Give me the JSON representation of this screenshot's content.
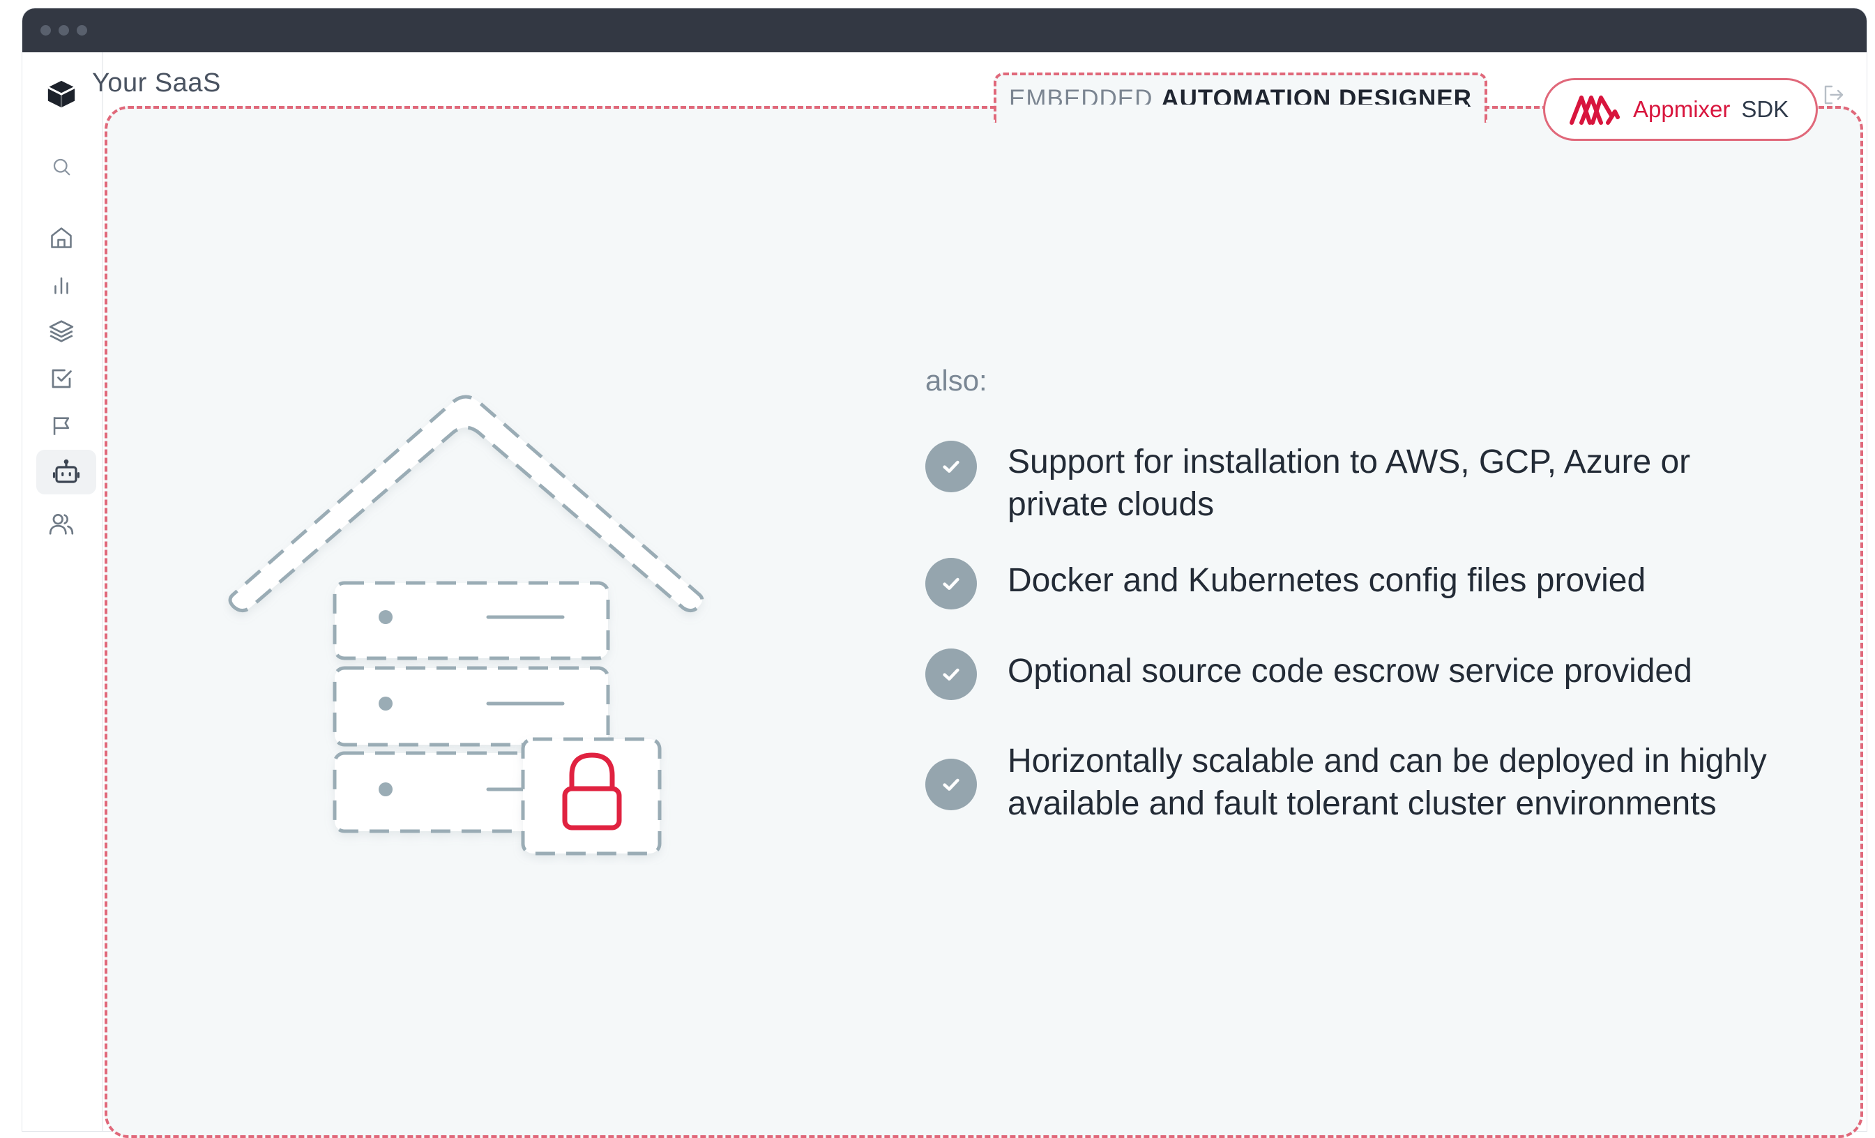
{
  "app": {
    "title": "Your SaaS"
  },
  "sidebar": {
    "items": [
      {
        "icon": "cube-logo-icon"
      },
      {
        "icon": "search-icon"
      },
      {
        "icon": "home-icon"
      },
      {
        "icon": "bar-chart-icon"
      },
      {
        "icon": "layers-icon"
      },
      {
        "icon": "checkbox-icon"
      },
      {
        "icon": "flag-icon"
      },
      {
        "icon": "robot-icon",
        "active": true
      },
      {
        "icon": "users-icon"
      }
    ]
  },
  "designer": {
    "label_muted": "EMBEDDED",
    "label_strong": "AUTOMATION DESIGNER"
  },
  "sdk_badge": {
    "name": "Appmixer",
    "tag": "SDK"
  },
  "content": {
    "intro": "also:",
    "features": [
      {
        "line1": "Support for installation to AWS, GCP, Azure or",
        "line2": "private clouds"
      },
      {
        "line1": "Docker and Kubernetes config files provied",
        "line2": ""
      },
      {
        "line1": "Optional source code escrow service provided",
        "line2": ""
      },
      {
        "line1": "Horizontally scalable and can be deployed in highly",
        "line2": "available and fault tolerant cluster environments"
      }
    ]
  },
  "colors": {
    "accent": "#e0687a",
    "brand_red": "#d8153d",
    "titlebar": "#333843",
    "panel_bg": "#f5f8f9",
    "check": "#95a5ae"
  }
}
